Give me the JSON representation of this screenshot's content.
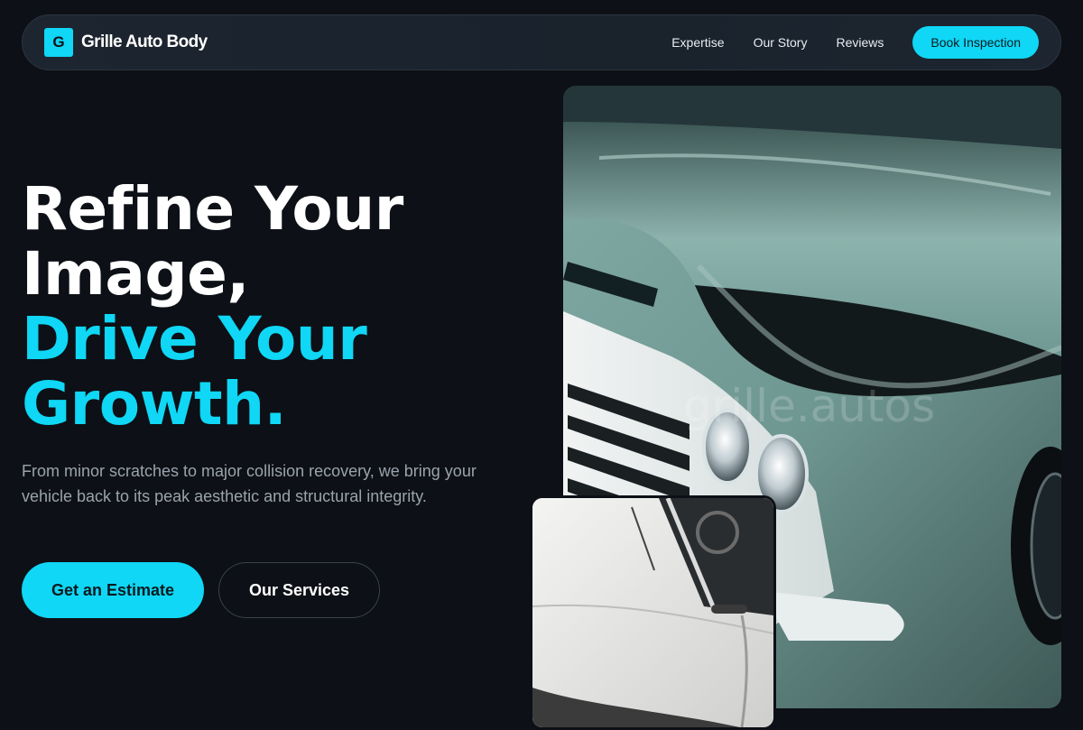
{
  "nav": {
    "logo_letter": "G",
    "brand": "Grille Auto Body",
    "links": [
      "Expertise",
      "Our Story",
      "Reviews"
    ],
    "cta": "Book Inspection"
  },
  "hero": {
    "headline_white": [
      "Refine Your",
      "Image,"
    ],
    "headline_accent": [
      "Drive Your",
      "Growth."
    ],
    "description": "From minor scratches to major collision recovery, we bring your vehicle back to its peak aesthetic and structural integrity.",
    "primary_button": "Get an Estimate",
    "secondary_button": "Our Services"
  },
  "images": {
    "main_alt": "Close-up of a vintage teal truck front with chrome grille and headlights",
    "main_watermark": "grille.autos",
    "small_alt": "White classic car door with open window frame"
  },
  "colors": {
    "background": "#0d1016",
    "accent": "#0fd7f5",
    "muted_text": "#9aa3ad"
  }
}
